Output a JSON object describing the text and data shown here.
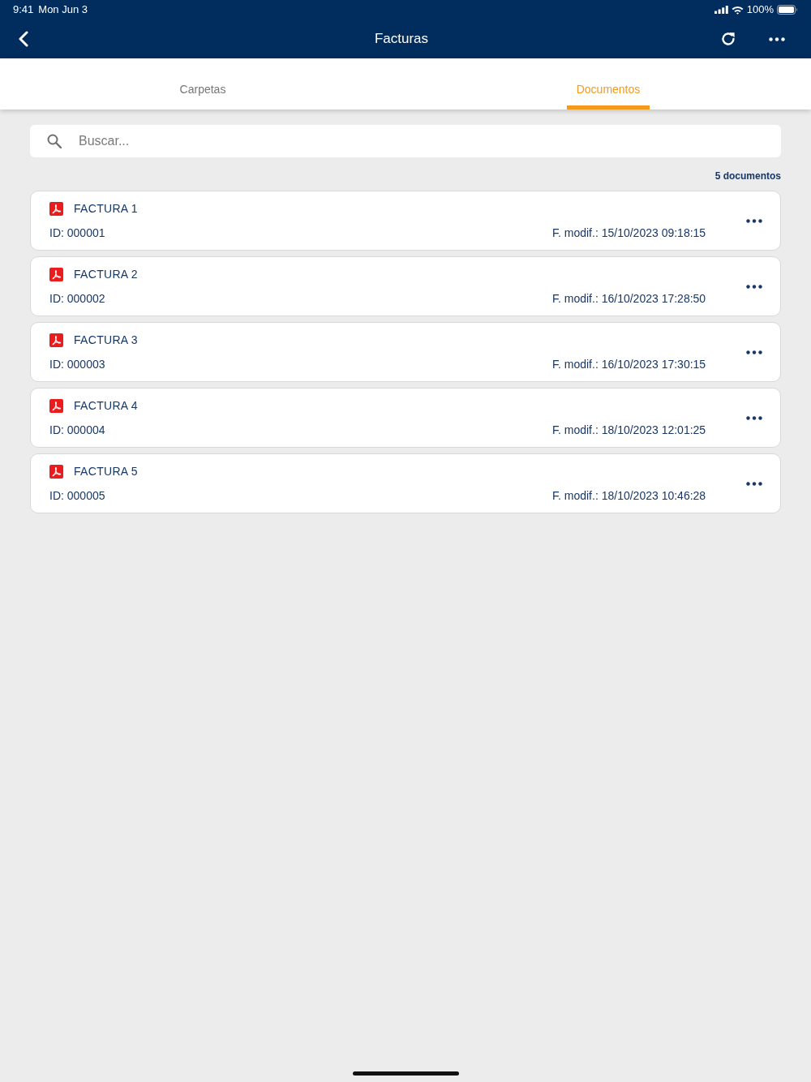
{
  "status_bar": {
    "time": "9:41",
    "date": "Mon Jun 3",
    "battery": "100%"
  },
  "nav_bar": {
    "title": "Facturas"
  },
  "tabs": [
    {
      "label": "Carpetas",
      "selected": false
    },
    {
      "label": "Documentos",
      "selected": true
    }
  ],
  "search": {
    "placeholder": "Buscar..."
  },
  "count": "5 documentos",
  "documents": [
    {
      "title": "FACTURA 1",
      "id": "ID: 000001",
      "modified": "F. modif.: 15/10/2023 09:18:15"
    },
    {
      "title": "FACTURA 2",
      "id": "ID: 000002",
      "modified": "F. modif.: 16/10/2023 17:28:50"
    },
    {
      "title": "FACTURA 3",
      "id": "ID: 000003",
      "modified": "F. modif.: 16/10/2023 17:30:15"
    },
    {
      "title": "FACTURA 4",
      "id": "ID: 000004",
      "modified": "F. modif.: 18/10/2023 12:01:25"
    },
    {
      "title": "FACTURA 5",
      "id": "ID: 000005",
      "modified": "F. modif.: 18/10/2023 10:46:28"
    }
  ]
}
